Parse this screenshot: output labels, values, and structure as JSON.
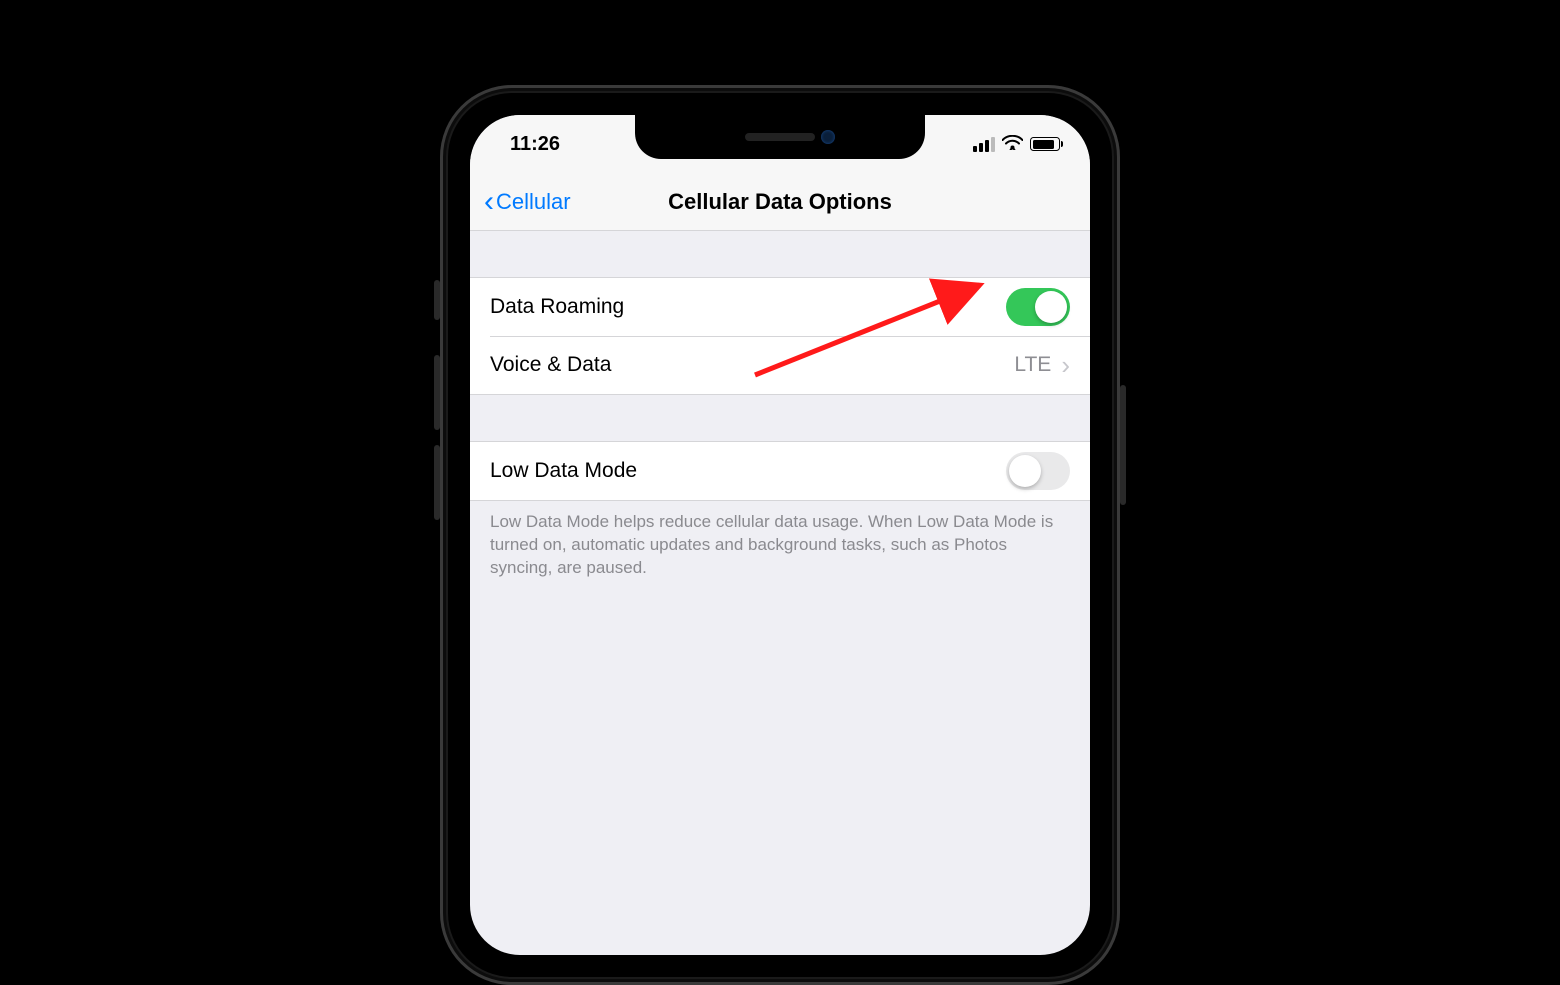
{
  "status": {
    "time": "11:26"
  },
  "nav": {
    "back_label": "Cellular",
    "title": "Cellular Data Options"
  },
  "rows": {
    "data_roaming": {
      "label": "Data Roaming",
      "on": true
    },
    "voice_data": {
      "label": "Voice & Data",
      "value": "LTE"
    },
    "low_data": {
      "label": "Low Data Mode",
      "on": false
    }
  },
  "footer": {
    "low_data_text": "Low Data Mode helps reduce cellular data usage. When Low Data Mode is turned on, automatic updates and background tasks, such as Photos syncing, are paused."
  }
}
